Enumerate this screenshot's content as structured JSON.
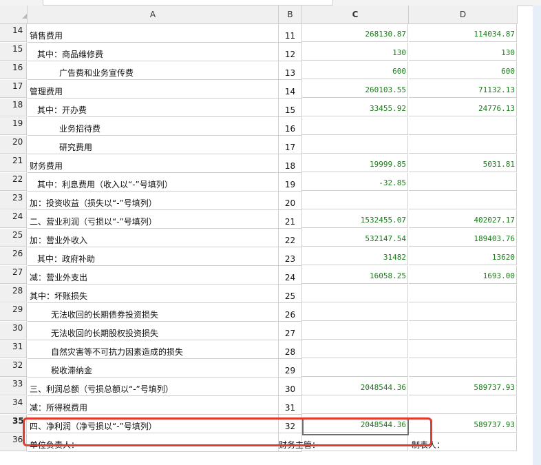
{
  "name_box": "",
  "columns": [
    "A",
    "B",
    "C",
    "D"
  ],
  "rows": [
    {
      "rownum": "14",
      "label": "销售费用",
      "indent": 0,
      "b": "11",
      "c": "268130.87",
      "d": "114034.87"
    },
    {
      "rownum": "15",
      "label": "其中：商品维修费",
      "indent": 1,
      "b": "12",
      "c": "130",
      "d": "130"
    },
    {
      "rownum": "16",
      "label": "广告费和业务宣传费",
      "indent": 2,
      "b": "13",
      "c": "600",
      "d": "600"
    },
    {
      "rownum": "17",
      "label": "管理费用",
      "indent": 0,
      "b": "14",
      "c": "260103.55",
      "d": "71132.13"
    },
    {
      "rownum": "18",
      "label": "其中：开办费",
      "indent": 1,
      "b": "15",
      "c": "33455.92",
      "d": "24776.13"
    },
    {
      "rownum": "19",
      "label": "业务招待费",
      "indent": 2,
      "b": "16",
      "c": "",
      "d": ""
    },
    {
      "rownum": "20",
      "label": "研究费用",
      "indent": 2,
      "b": "17",
      "c": "",
      "d": ""
    },
    {
      "rownum": "21",
      "label": "财务费用",
      "indent": 0,
      "b": "18",
      "c": "19999.85",
      "d": "5031.81"
    },
    {
      "rownum": "22",
      "label": "其中：利息费用（收入以“-”号填列）",
      "indent": 1,
      "b": "19",
      "c": "-32.85",
      "d": ""
    },
    {
      "rownum": "23",
      "label": "加：投资收益（损失以“-”号填列）",
      "indent": 0,
      "b": "20",
      "c": "",
      "d": ""
    },
    {
      "rownum": "24",
      "label": "二、营业利润（亏损以“-”号填列）",
      "indent": 0,
      "b": "21",
      "c": "1532455.07",
      "d": "402027.17"
    },
    {
      "rownum": "25",
      "label": "加：营业外收入",
      "indent": 0,
      "b": "22",
      "c": "532147.54",
      "d": "189403.76"
    },
    {
      "rownum": "26",
      "label": "其中：政府补助",
      "indent": 1,
      "b": "23",
      "c": "31482",
      "d": "13620"
    },
    {
      "rownum": "27",
      "label": "减：营业外支出",
      "indent": 0,
      "b": "24",
      "c": "16058.25",
      "d": "1693.00"
    },
    {
      "rownum": "28",
      "label": "其中：坏账损失",
      "indent": 0,
      "b": "25",
      "c": "",
      "d": ""
    },
    {
      "rownum": "29",
      "label": "无法收回的长期债券投资损失",
      "indent": 3,
      "b": "26",
      "c": "",
      "d": ""
    },
    {
      "rownum": "30",
      "label": "无法收回的长期股权投资损失",
      "indent": 3,
      "b": "27",
      "c": "",
      "d": ""
    },
    {
      "rownum": "31",
      "label": "自然灾害等不可抗力因素造成的损失",
      "indent": 3,
      "b": "28",
      "c": "",
      "d": ""
    },
    {
      "rownum": "32",
      "label": "税收滞纳金",
      "indent": 3,
      "b": "29",
      "c": "",
      "d": ""
    },
    {
      "rownum": "33",
      "label": "三、利润总额（亏损总额以“-”号填列）",
      "indent": 0,
      "b": "30",
      "c": "2048544.36",
      "d": "589737.93"
    },
    {
      "rownum": "34",
      "label": "减：所得税费用",
      "indent": 0,
      "b": "31",
      "c": "",
      "d": ""
    },
    {
      "rownum": "35",
      "label": "四、净利润（净亏损以“-”号填列）",
      "indent": 0,
      "b": "32",
      "c": "2048544.36",
      "d": "589737.93"
    },
    {
      "rownum": "36",
      "label": "单位负责人：",
      "indent": 0,
      "b": "财务主管：",
      "c": "",
      "d": "制表人："
    }
  ],
  "active_row": "35",
  "selected_cell": "C35",
  "colors": {
    "number_text": "#1a7a1a",
    "highlight_border": "#e23a2c"
  }
}
